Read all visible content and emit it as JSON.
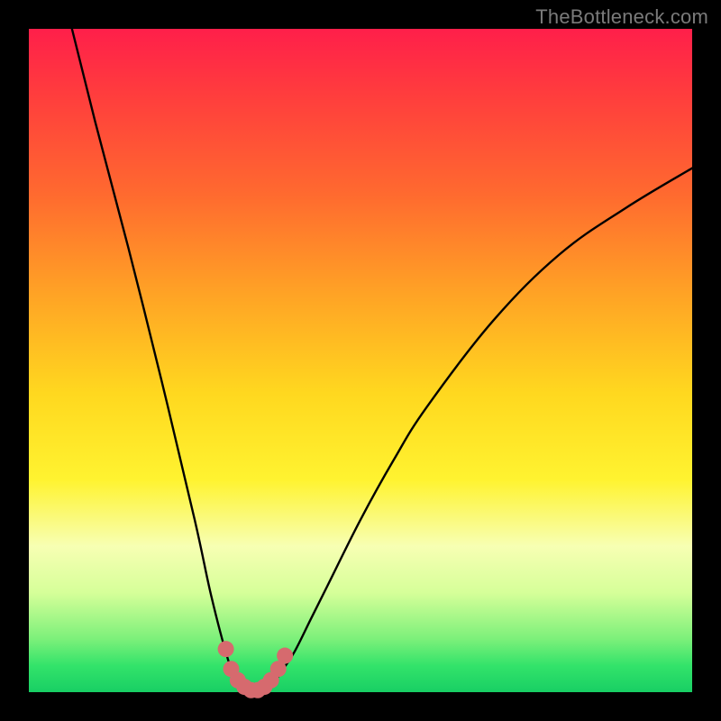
{
  "watermark": {
    "text": "TheBottleneck.com"
  },
  "chart_data": {
    "type": "line",
    "title": "",
    "xlabel": "",
    "ylabel": "",
    "xlim": [
      0,
      1
    ],
    "ylim": [
      0,
      1
    ],
    "series": [
      {
        "name": "bottleneck-curve",
        "x": [
          0.065,
          0.1,
          0.15,
          0.2,
          0.25,
          0.275,
          0.3,
          0.31,
          0.32,
          0.33,
          0.34,
          0.35,
          0.36,
          0.37,
          0.38,
          0.4,
          0.425,
          0.45,
          0.5,
          0.55,
          0.6,
          0.7,
          0.8,
          0.9,
          1.0
        ],
        "y": [
          1.0,
          0.86,
          0.67,
          0.47,
          0.26,
          0.145,
          0.05,
          0.03,
          0.015,
          0.005,
          0.0,
          0.0,
          0.005,
          0.015,
          0.03,
          0.06,
          0.11,
          0.16,
          0.26,
          0.35,
          0.43,
          0.56,
          0.66,
          0.73,
          0.79
        ]
      }
    ],
    "highlighted_points": {
      "name": "bottom-dots",
      "color": "#d66a6e",
      "points": [
        {
          "x": 0.297,
          "y": 0.065
        },
        {
          "x": 0.305,
          "y": 0.035
        },
        {
          "x": 0.315,
          "y": 0.018
        },
        {
          "x": 0.325,
          "y": 0.008
        },
        {
          "x": 0.335,
          "y": 0.003
        },
        {
          "x": 0.345,
          "y": 0.003
        },
        {
          "x": 0.355,
          "y": 0.008
        },
        {
          "x": 0.365,
          "y": 0.018
        },
        {
          "x": 0.376,
          "y": 0.035
        },
        {
          "x": 0.386,
          "y": 0.055
        }
      ]
    }
  }
}
